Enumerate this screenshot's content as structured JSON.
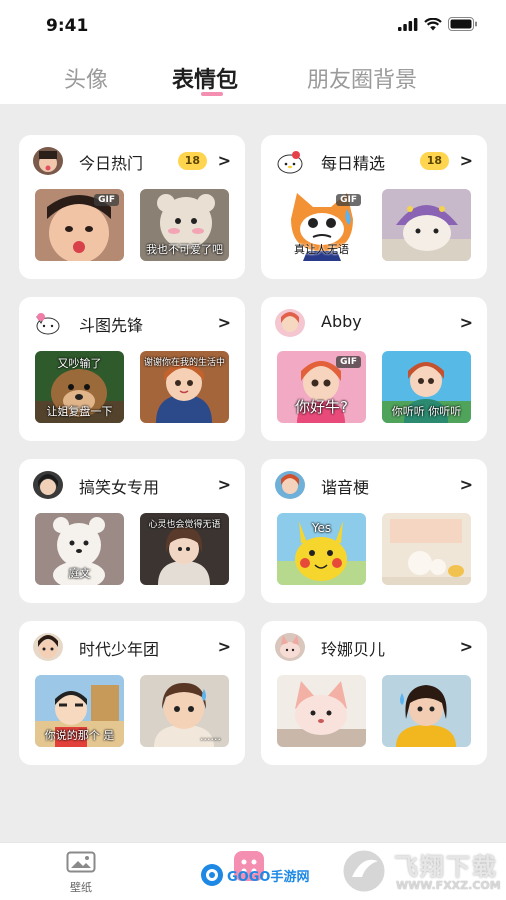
{
  "status": {
    "time": "9:41"
  },
  "tabs": [
    {
      "label": "头像",
      "active": false
    },
    {
      "label": "表情包",
      "active": true
    },
    {
      "label": "朋友圈背景",
      "active": false
    }
  ],
  "cards": [
    {
      "title": "今日热门",
      "badge": "18",
      "thumbs": [
        {
          "gif": "GIF",
          "caption": ""
        },
        {
          "gif": "",
          "caption": "我也不可爱了吧"
        }
      ]
    },
    {
      "title": "每日精选",
      "badge": "18",
      "thumbs": [
        {
          "gif": "GIF",
          "caption": "真让人无语"
        },
        {
          "gif": "",
          "caption": ""
        }
      ]
    },
    {
      "title": "斗图先锋",
      "badge": "",
      "thumbs": [
        {
          "gif": "",
          "caption_top": "又吵输了",
          "caption": "让姐复盘一下"
        },
        {
          "gif": "",
          "caption_top": "谢谢你在我的生活中",
          "caption": ""
        }
      ]
    },
    {
      "title": "Abby",
      "badge": "",
      "thumbs": [
        {
          "gif": "GIF",
          "caption": "你好牛?"
        },
        {
          "gif": "",
          "caption": "你听听 你听听"
        }
      ]
    },
    {
      "title": "搞笑女专用",
      "badge": "",
      "thumbs": [
        {
          "gif": "",
          "caption": "庭文"
        },
        {
          "gif": "",
          "caption_top": "心灵也会觉得无语",
          "caption": ""
        }
      ]
    },
    {
      "title": "谐音梗",
      "badge": "",
      "thumbs": [
        {
          "gif": "",
          "caption": "Yes"
        },
        {
          "gif": "",
          "caption": ""
        }
      ]
    },
    {
      "title": "时代少年团",
      "badge": "",
      "thumbs": [
        {
          "gif": "",
          "caption": "你说的那个 是"
        },
        {
          "gif": "",
          "caption": "......"
        }
      ]
    },
    {
      "title": "玲娜贝儿",
      "badge": "",
      "thumbs": [
        {
          "gif": "",
          "caption": ""
        },
        {
          "gif": "",
          "caption": ""
        }
      ]
    }
  ],
  "bottom_nav": {
    "wallpaper_label": "壁纸"
  },
  "watermarks": {
    "left_text": "GOGO手游网",
    "right_text": "飞翔下载",
    "right_url": "WWW.FXXZ.COM"
  },
  "colors": {
    "accent": "#f48fb1",
    "badge": "#ffd54f",
    "page_bg": "#ececec"
  },
  "icons": {
    "arrow": "chevron-right-icon",
    "signal": "signal-icon",
    "wifi": "wifi-icon",
    "battery": "battery-icon",
    "wallpaper": "image-icon"
  }
}
